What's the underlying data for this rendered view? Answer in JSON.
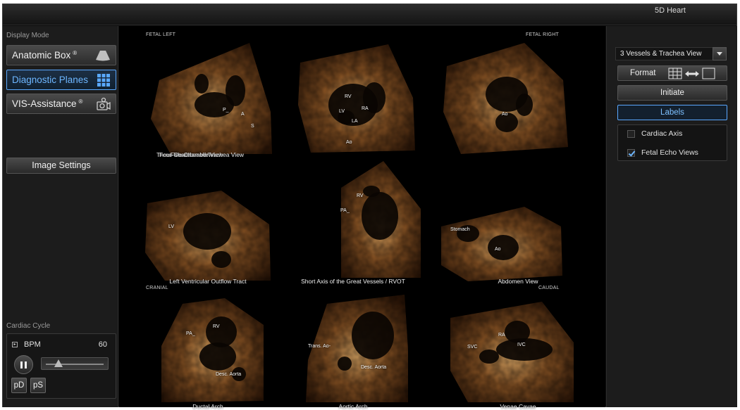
{
  "app": {
    "title": "5D Heart"
  },
  "left": {
    "display_mode_label": "Display Mode",
    "modes": [
      {
        "label": "Anatomic Box",
        "mark": "®",
        "icon": "ultrasound-fan-icon"
      },
      {
        "label": "Diagnostic Planes",
        "mark": "",
        "icon": "grid-icon"
      },
      {
        "label": "VIS-Assistance",
        "mark": "®",
        "icon": "camera-gear-icon"
      }
    ],
    "image_settings_label": "Image Settings",
    "cardiac_cycle_label": "Cardiac Cycle",
    "bpm_label": "BPM",
    "bpm_value": "60",
    "bpm_slider_fraction": 0.22,
    "pd_label": "pD",
    "ps_label": "pS"
  },
  "center": {
    "corner_labels": {
      "fetal_left": "FETAL LEFT",
      "fetal_right": "FETAL RIGHT",
      "cranial": "CRANIAL",
      "caudal": "CAUDAL"
    },
    "views": [
      {
        "caption": "Three Vessels and Trachea View",
        "labels": [
          "P_",
          "A",
          "S"
        ]
      },
      {
        "caption": "Four-Chamber View",
        "labels": [
          "RV",
          "LV",
          "RA",
          "LA",
          "Ao"
        ]
      },
      {
        "caption": "Five-Chamber View",
        "labels": [
          "Ao"
        ]
      },
      {
        "caption": "Left Ventricular Outflow Tract",
        "labels": [
          "LV"
        ]
      },
      {
        "caption": "Short Axis of the Great Vessels / RVOT",
        "labels": [
          "RV",
          "PA_"
        ]
      },
      {
        "caption": "Abdomen View",
        "labels": [
          "Stomach",
          "Ao"
        ]
      },
      {
        "caption": "Ductal Arch",
        "labels": [
          "RV",
          "PA_",
          "Desc. Aorta"
        ]
      },
      {
        "caption": "Aortic Arch",
        "labels": [
          "Trans. Ao-",
          "Desc. Aorta"
        ]
      },
      {
        "caption": "Venae Cavae",
        "labels": [
          "RA",
          "SVC",
          "IVC"
        ]
      }
    ]
  },
  "right": {
    "view_select": "3 Vessels & Trachea View",
    "format_label": "Format",
    "initiate_label": "Initiate",
    "labels_label": "Labels",
    "cardiac_axis_label": "Cardiac Axis",
    "cardiac_axis_checked": false,
    "fetal_echo_label": "Fetal Echo Views",
    "fetal_echo_checked": true
  },
  "colors": {
    "accent": "#5aa8ff",
    "panel": "#1c1c1c",
    "ultrasound_dark": "#2a1406",
    "ultrasound_mid": "#8a5424",
    "ultrasound_bright": "#e7b06a"
  }
}
